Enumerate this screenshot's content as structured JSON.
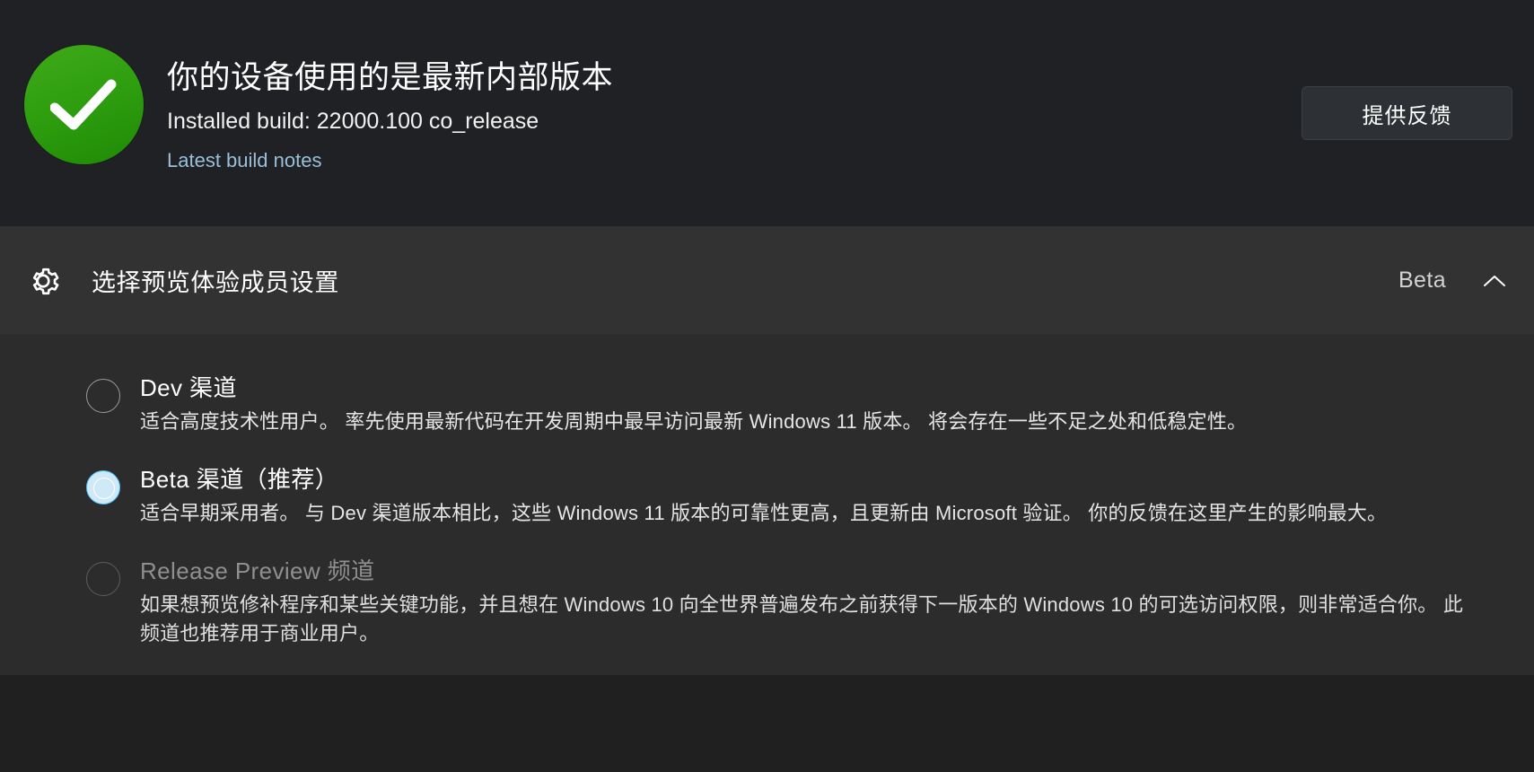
{
  "status": {
    "icon": "success-check-icon",
    "title": "你的设备使用的是最新内部版本",
    "build": "Installed build: 22000.100 co_release",
    "notes_link": "Latest build notes",
    "feedback_button": "提供反馈",
    "accent_color": "#2f9f0f"
  },
  "expander": {
    "icon": "gear-icon",
    "title": "选择预览体验成员设置",
    "selected_value": "Beta",
    "chevron": "chevron-up-icon",
    "expanded": true
  },
  "channels": [
    {
      "id": "dev",
      "label": "Dev 渠道",
      "description": "适合高度技术性用户。 率先使用最新代码在开发周期中最早访问最新 Windows 11 版本。 将会存在一些不足之处和低稳定性。",
      "selected": false,
      "disabled": false
    },
    {
      "id": "beta",
      "label": "Beta 渠道（推荐）",
      "description": "适合早期采用者。 与 Dev 渠道版本相比，这些 Windows 11 版本的可靠性更高，且更新由 Microsoft 验证。 你的反馈在这里产生的影响最大。",
      "selected": true,
      "disabled": false
    },
    {
      "id": "release-preview",
      "label": "Release Preview 频道",
      "description": "如果想预览修补程序和某些关键功能，并且想在 Windows 10 向全世界普遍发布之前获得下一版本的 Windows 10 的可选访问权限，则非常适合你。 此频道也推荐用于商业用户。",
      "selected": false,
      "disabled": true
    }
  ]
}
